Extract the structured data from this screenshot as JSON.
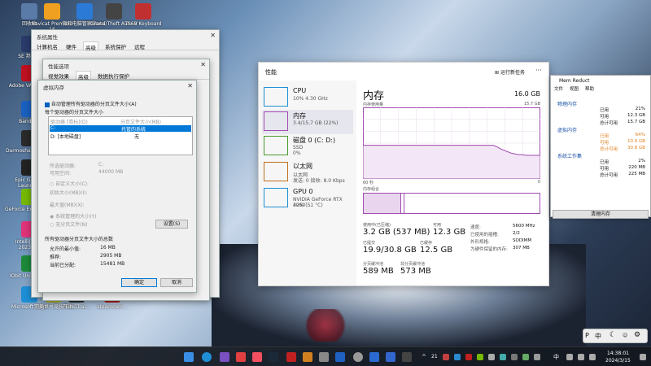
{
  "desktop_icons": [
    {
      "label": "回收站",
      "color": "#5a7aa8"
    },
    {
      "label": "Navicat Premium 16",
      "color": "#f0a020"
    },
    {
      "label": "微软电脑管家(Beta)",
      "color": "#2b7bd6"
    },
    {
      "label": "Grand Theft Auto V",
      "color": "#444444"
    },
    {
      "label": "TS68 Keyboard",
      "color": "#c03030"
    },
    {
      "label": "SE\n邦保护",
      "color": "#2a3a6a"
    },
    {
      "label": "Adobe VALORA...",
      "color": "#c01020"
    },
    {
      "label": "Bandizip",
      "color": "#1a60c0"
    },
    {
      "label": "Darmoshark Mouse",
      "color": "#2a2a2a"
    },
    {
      "label": "Epic Games Launcher",
      "color": "#222222"
    },
    {
      "label": "GeForce Experience",
      "color": "#76b900"
    },
    {
      "label": "IntelliJ IDEA 2023.3.4",
      "color": "#e0337a"
    },
    {
      "label": "IObit Uninstaller",
      "color": "#1d8a3a"
    },
    {
      "label": "Microsoft Edge",
      "color": "#1e8fd6"
    },
    {
      "label": "完美世界竞技平台",
      "color": "#c0c030"
    },
    {
      "label": "FLiNGTrai...",
      "color": "#333333"
    },
    {
      "label": "steamcom...",
      "color": "#c02020"
    },
    {
      "label": "for Enterpr...",
      "color": "#555555"
    },
    {
      "label": "Managem...",
      "color": "#555555"
    }
  ],
  "sysprops": {
    "title": "系统属性",
    "tabs": [
      "计算机名",
      "硬件",
      "高级",
      "系统保护",
      "远程"
    ],
    "ok": "确定",
    "cancel": "取消"
  },
  "perf": {
    "title": "性能选项",
    "tabs": [
      "视觉效果",
      "高级",
      "数据执行保护"
    ]
  },
  "vm": {
    "title": "虚拟内存",
    "auto_manage": "自动管理所有驱动器的分页文件大小(A)",
    "each_drive": "每个驱动器的分页文件大小",
    "col_drive": "驱动器 [卷标](D)",
    "col_size": "分页文件大小(MB)",
    "rows": [
      {
        "drive": "C:",
        "size": "托管的系统"
      },
      {
        "drive": "D:   [本地磁盘]",
        "size": "无"
      }
    ],
    "sel_drive_lbl": "所选驱动器:",
    "sel_drive_val": "C:",
    "free_lbl": "可用空间:",
    "free_val": "44000 MB",
    "custom": "自定义大小(C):",
    "initial": "初始大小(MB)(I):",
    "max": "最大值(MB)(X):",
    "sys_managed": "系统管理的大小(Y)",
    "no_paging": "无分页文件(N)",
    "set": "设置(S)",
    "total_title": "所有驱动器分页文件大小的总数",
    "min_lbl": "允许的最小值:",
    "min_val": "16 MB",
    "rec_lbl": "推荐:",
    "rec_val": "2905 MB",
    "cur_lbl": "当前已分配:",
    "cur_val": "15481 MB",
    "ok": "确定",
    "cancel": "取消"
  },
  "taskmgr": {
    "section": "性能",
    "run_task": "运行新任务",
    "resources": [
      {
        "name": "CPU",
        "sub1": "10% 4.30 GHz",
        "sub2": "",
        "color": "#1f8fd6"
      },
      {
        "name": "内存",
        "sub1": "3.4/15.7 GB (22%)",
        "sub2": "",
        "color": "#a04cb0"
      },
      {
        "name": "磁盘 0 (C: D:)",
        "sub1": "SSD",
        "sub2": "0%",
        "color": "#4a9a30"
      },
      {
        "name": "以太网",
        "sub1": "以太网",
        "sub2": "发送: 0 接收: 8.0 Kbps",
        "color": "#c07020"
      },
      {
        "name": "GPU 0",
        "sub1": "NVIDIA GeForce RTX 4060 ...",
        "sub2": "32% (51 °C)",
        "color": "#1f8fd6"
      }
    ],
    "title": "内存",
    "total": "16.0 GB",
    "usage_lbl": "内存使用量",
    "usage_max": "15.7 GB",
    "time_lbl": "60 秒",
    "time_zero": "0",
    "comp_lbl": "内存组合",
    "stats": [
      {
        "label": "使用中(已压缩)",
        "value": "3.2 GB (537 MB)"
      },
      {
        "label": "可用",
        "value": "12.3 GB"
      },
      {
        "label": "已提交",
        "value": "19.9/30.8 GB"
      },
      {
        "label": "已缓存",
        "value": "12.5 GB"
      },
      {
        "label": "分页缓冲池",
        "value": "589 MB"
      },
      {
        "label": "非分页缓冲池",
        "value": "573 MB"
      }
    ],
    "details": [
      {
        "label": "速度:",
        "value": "5600 MHz"
      },
      {
        "label": "已使用的插槽:",
        "value": "2/2"
      },
      {
        "label": "外形规格:",
        "value": "SODIMM"
      },
      {
        "label": "为硬件保留的内存:",
        "value": "307 MB"
      }
    ],
    "graph_usage": [
      0.47,
      0.47,
      0.47,
      0.47,
      0.47,
      0.47,
      0.47,
      0.47,
      0.47,
      0.47,
      0.47,
      0.47,
      0.47,
      0.47,
      0.47,
      0.47,
      0.47,
      0.47,
      0.47,
      0.47,
      0.47,
      0.47,
      0.47,
      0.47,
      0.47,
      0.47,
      0.47,
      0.47,
      0.47,
      0.47,
      0.47,
      0.47,
      0.47,
      0.47,
      0.47,
      0.47,
      0.47,
      0.45,
      0.42,
      0.4,
      0.38,
      0.36,
      0.35,
      0.34,
      0.34,
      0.33,
      0.33,
      0.33,
      0.33,
      0.33
    ]
  },
  "memreduct": {
    "title": "Mem Reduct",
    "menu": [
      "文件",
      "视图",
      "帮助"
    ],
    "phys_title": "物理内存",
    "phys": [
      {
        "k": "已用",
        "v": "21%"
      },
      {
        "k": "可用",
        "v": "12.3 GB"
      },
      {
        "k": "总计可用",
        "v": "15.7 GB"
      }
    ],
    "virt_title": "虚拟内存",
    "virt": [
      {
        "k": "已用",
        "v": "64%"
      },
      {
        "k": "可用",
        "v": "10.9 GB"
      },
      {
        "k": "总计可用",
        "v": "30.8 GB"
      }
    ],
    "cache_title": "系统工作集",
    "cache": [
      {
        "k": "已用",
        "v": "2%"
      },
      {
        "k": "可用",
        "v": "220 MB"
      },
      {
        "k": "总计可用",
        "v": "225 MB"
      }
    ],
    "clean": "清理内存"
  },
  "tray": {
    "ime": "中",
    "time": "14:38:01",
    "date": "2024/3/15",
    "temp": "21"
  }
}
